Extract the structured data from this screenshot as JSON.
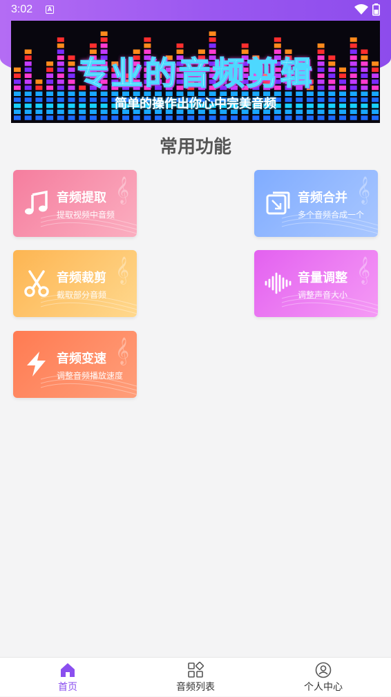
{
  "status_bar": {
    "time": "3:02"
  },
  "banner": {
    "title": "专业的音频剪辑",
    "subtitle": "简单的操作出你心中完美音频"
  },
  "section_title": "常用功能",
  "features": [
    {
      "title": "音频提取",
      "desc": "提取视频中音频",
      "icon": "music-note-icon"
    },
    {
      "title": "音频合并",
      "desc": "多个音频合成一个",
      "icon": "merge-icon"
    },
    {
      "title": "音频裁剪",
      "desc": "截取部分音频",
      "icon": "scissors-icon"
    },
    {
      "title": "音量调整",
      "desc": "调整声音大小",
      "icon": "sound-wave-icon"
    },
    {
      "title": "音频变速",
      "desc": "调整音频播放速度",
      "icon": "lightning-icon"
    }
  ],
  "tabs": [
    {
      "label": "首页",
      "icon": "home-icon",
      "active": true
    },
    {
      "label": "音频列表",
      "icon": "grid-icon",
      "active": false
    },
    {
      "label": "个人中心",
      "icon": "user-icon",
      "active": false
    }
  ],
  "colors": {
    "accent": "#8a4fef",
    "header_purple": "#9a57f0",
    "extract_card": "#f57d9e",
    "merge_card": "#80acff",
    "cut_card": "#fdb552",
    "volume_card": "#e361f0",
    "speed_card": "#ff7b52"
  }
}
